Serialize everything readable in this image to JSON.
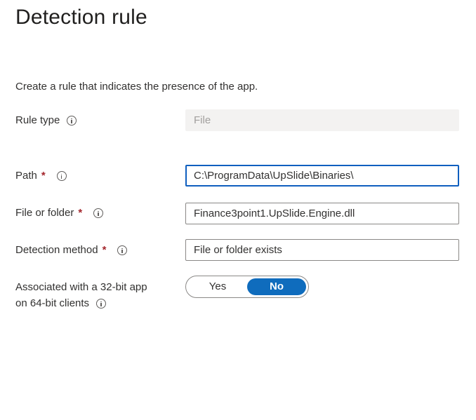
{
  "page": {
    "title": "Detection rule",
    "description": "Create a rule that indicates the presence of the app."
  },
  "form": {
    "rule_type": {
      "label": "Rule type",
      "value": "File"
    },
    "path": {
      "label": "Path",
      "required_mark": "*",
      "value": "C:\\ProgramData\\UpSlide\\Binaries\\"
    },
    "file_or_folder": {
      "label": "File or folder",
      "required_mark": "*",
      "value": "Finance3point1.UpSlide.Engine.dll"
    },
    "detection_method": {
      "label": "Detection method",
      "required_mark": "*",
      "value": "File or folder exists"
    },
    "associated_32bit": {
      "label_line1": "Associated with a 32-bit app",
      "label_line2": "on 64-bit clients",
      "options": [
        "Yes",
        "No"
      ],
      "selected": "No"
    }
  },
  "icons": {
    "info": "info-icon"
  },
  "colors": {
    "accent": "#0f6cbd",
    "required": "#a4262c",
    "disabled_bg": "#f3f2f1"
  }
}
